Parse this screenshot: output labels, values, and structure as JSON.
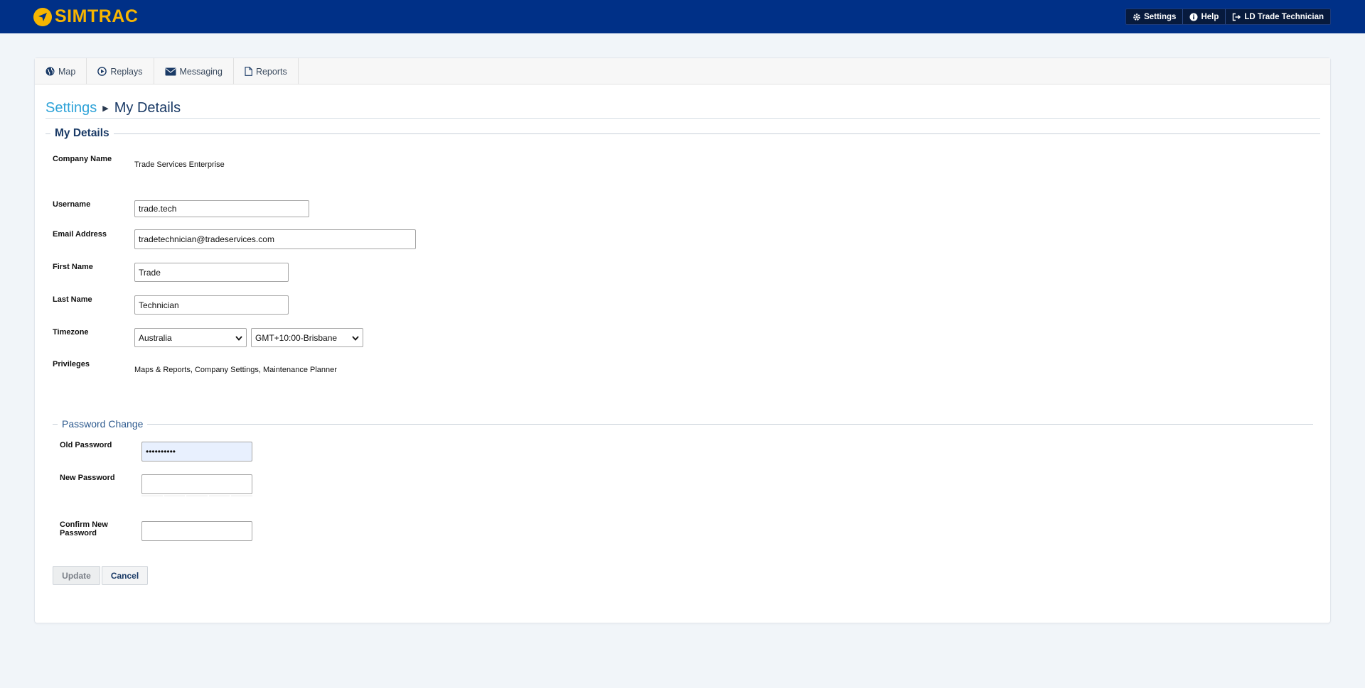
{
  "app": {
    "logo_text": "SIMTRAC",
    "brand_color": "#003087",
    "accent_color": "#f7b500"
  },
  "top_nav": {
    "settings": {
      "label": "Settings",
      "icon": "gear-icon"
    },
    "help": {
      "label": "Help",
      "icon": "info-icon"
    },
    "user": {
      "label": "LD Trade Technician",
      "icon": "sign-out-icon"
    }
  },
  "tabs": [
    {
      "label": "Map",
      "icon": "globe-icon"
    },
    {
      "label": "Replays",
      "icon": "play-circle-icon"
    },
    {
      "label": "Messaging",
      "icon": "envelope-icon"
    },
    {
      "label": "Reports",
      "icon": "file-icon"
    }
  ],
  "breadcrumb": {
    "parent": "Settings",
    "current": "My Details"
  },
  "details": {
    "section_title": "My Details",
    "company_name": {
      "label": "Company Name",
      "value": "Trade Services Enterprise"
    },
    "username": {
      "label": "Username",
      "value": "trade.tech"
    },
    "email": {
      "label": "Email Address",
      "value": "tradetechnician@tradeservices.com"
    },
    "first_name": {
      "label": "First Name",
      "value": "Trade"
    },
    "last_name": {
      "label": "Last Name",
      "value": "Technician"
    },
    "timezone": {
      "label": "Timezone",
      "region": "Australia",
      "zone": "GMT+10:00-Brisbane"
    },
    "privileges": {
      "label": "Privileges",
      "value": "Maps & Reports, Company Settings, Maintenance Planner"
    }
  },
  "password": {
    "section_title": "Password Change",
    "old": {
      "label": "Old Password",
      "value": "••••••••••"
    },
    "new": {
      "label": "New Password",
      "value": ""
    },
    "confirm": {
      "label_line1": "Confirm New",
      "label_line2": "Password",
      "value": ""
    }
  },
  "actions": {
    "update": "Update",
    "cancel": "Cancel"
  }
}
